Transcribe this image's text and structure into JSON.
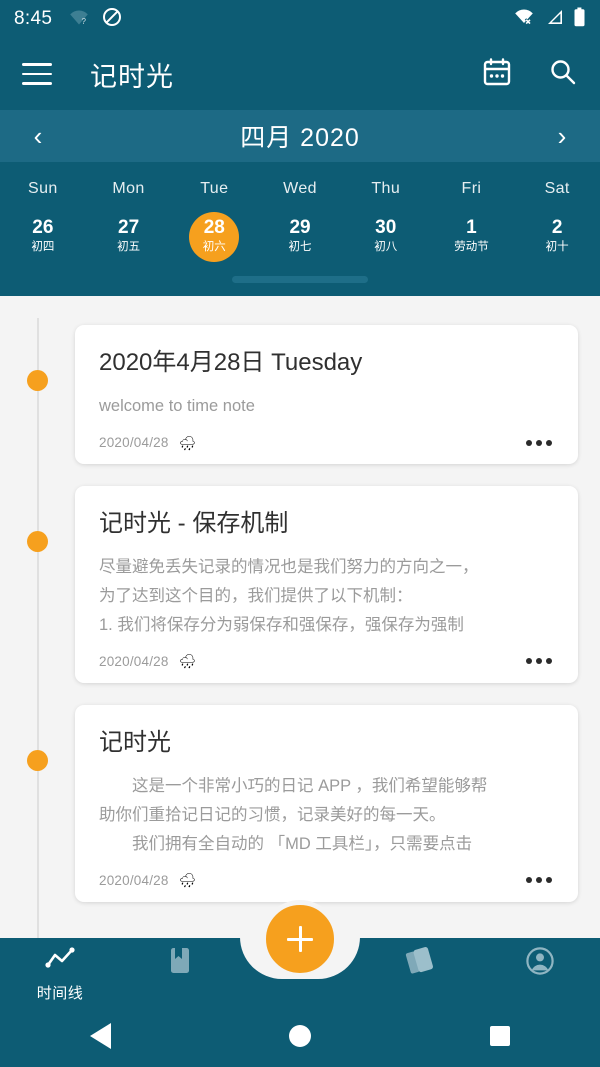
{
  "status_bar": {
    "time": "8:45",
    "left_icons": [
      "wifi-question-icon",
      "do-not-disturb-icon"
    ],
    "right_icons": [
      "wifi-off-icon",
      "cell-signal-icon",
      "battery-icon"
    ]
  },
  "app_bar": {
    "menu_icon": "hamburger-menu-icon",
    "title": "记时光",
    "calendar_icon": "calendar-icon",
    "search_icon": "search-icon"
  },
  "calendar": {
    "prev_label": "‹",
    "next_label": "›",
    "month_label": "四月 2020",
    "weekday_headers": [
      "Sun",
      "Mon",
      "Tue",
      "Wed",
      "Thu",
      "Fri",
      "Sat"
    ],
    "days": [
      {
        "num": "26",
        "lunar": "初四",
        "selected": false
      },
      {
        "num": "27",
        "lunar": "初五",
        "selected": false
      },
      {
        "num": "28",
        "lunar": "初六",
        "selected": true
      },
      {
        "num": "29",
        "lunar": "初七",
        "selected": false
      },
      {
        "num": "30",
        "lunar": "初八",
        "selected": false
      },
      {
        "num": "1",
        "lunar": "劳动节",
        "selected": false
      },
      {
        "num": "2",
        "lunar": "初十",
        "selected": false
      }
    ]
  },
  "entries": [
    {
      "title": "2020年4月28日 Tuesday",
      "lines": [
        "welcome to time note"
      ],
      "date": "2020/04/28",
      "weather": "🌧",
      "more_label": "more-options"
    },
    {
      "title": "记时光 - 保存机制",
      "lines": [
        "尽量避免丢失记录的情况也是我们努力的方向之一，",
        "为了达到这个目的，我们提供了以下机制：",
        "1. 我们将保存分为弱保存和强保存，强保存为强制"
      ],
      "date": "2020/04/28",
      "weather": "🌧",
      "more_label": "more-options"
    },
    {
      "title": "记时光",
      "lines": [
        "　　这是一个非常小巧的日记 APP ，我们希望能够帮",
        "助你们重拾记日记的习惯，记录美好的每一天。",
        "　　我们拥有全自动的 「MD 工具栏」，只需要点击"
      ],
      "date": "2020/04/28",
      "weather": "🌧",
      "more_label": "more-options"
    }
  ],
  "bottom_nav": {
    "items": [
      {
        "icon": "timeline-icon",
        "label": "时间线",
        "active": true
      },
      {
        "icon": "notebook-icon",
        "label": "",
        "active": false
      },
      {
        "icon": "cards-stack-icon",
        "label": "",
        "active": false
      },
      {
        "icon": "account-icon",
        "label": "",
        "active": false
      }
    ],
    "fab_label": "+"
  },
  "system_nav": {
    "back": "back-button",
    "home": "home-button",
    "recents": "recents-button"
  },
  "colors": {
    "primary": "#0d5c74",
    "primary_light": "#1d6a85",
    "accent": "#f6a01e",
    "page_bg": "#f4f4f4",
    "card_bg": "#ffffff",
    "title_text": "#303030",
    "body_text": "#9b9b9b"
  }
}
